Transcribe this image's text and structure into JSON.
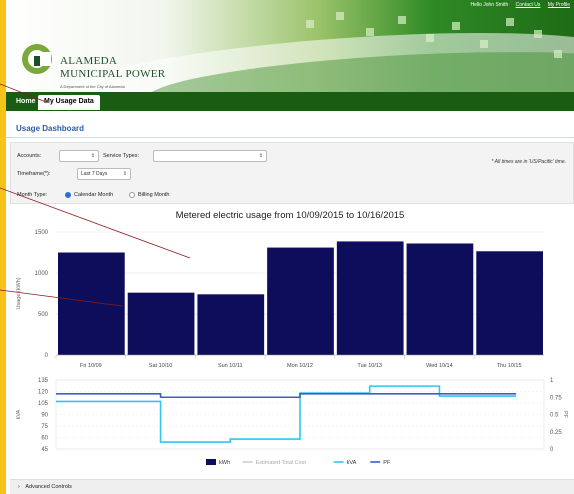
{
  "header": {
    "user_name": "Hello John Smith",
    "links": [
      "Contact Us",
      "My Profile"
    ],
    "brand_line1": "ALAMEDA",
    "brand_line2": "MUNICIPAL POWER",
    "tagline": "A Department of the City of Alameda"
  },
  "nav": {
    "tabs": [
      "Home",
      "My Usage Data"
    ],
    "active": "My Usage Data"
  },
  "dashboard": {
    "title": "Usage Dashboard"
  },
  "controls": {
    "accounts_label": "Accounts:",
    "accounts_value": "",
    "service_types_label": "Service Types:",
    "service_types_value": "",
    "timeframe_label": "Timeframe(*):",
    "timeframe_value": "Last 7 Days",
    "month_type_label": "Month Type:",
    "month_options": [
      "Calendar Month",
      "Billing Month"
    ],
    "month_selected": "Calendar Month",
    "tz_note": "* All times are in 'US/Pacific' time."
  },
  "chart_data": [
    {
      "type": "bar",
      "title": "Metered electric usage from 10/09/2015 to 10/16/2015",
      "ylabel": "Usage (kWh)",
      "categories": [
        "Fri 10/09",
        "Sat 10/10",
        "Sun 10/11",
        "Mon 10/12",
        "Tue 10/13",
        "Wed 10/14",
        "Thu 10/15"
      ],
      "values": [
        1250,
        760,
        740,
        1310,
        1385,
        1360,
        1265
      ],
      "ylim": [
        0,
        1500
      ],
      "yticks": [
        0,
        500,
        1000,
        1500
      ],
      "color": "#0d0d5c"
    },
    {
      "type": "line",
      "ylabel_left": "kVA",
      "ylabel_right": "PF",
      "yticks_left": [
        45,
        60,
        75,
        90,
        105,
        120,
        135
      ],
      "yticks_right": [
        "0",
        "0.25",
        "0.5",
        "0.75",
        "1"
      ],
      "ylim_left": [
        45,
        135
      ],
      "ylim_right": [
        0,
        1
      ],
      "series": [
        {
          "name": "kVA",
          "color": "#2fc6f0",
          "axis": "left",
          "steps": [
            {
              "from": 0,
              "to": 1.5,
              "value": 107
            },
            {
              "from": 1.5,
              "to": 2.5,
              "value": 54
            },
            {
              "from": 2.5,
              "to": 3.5,
              "value": 58
            },
            {
              "from": 3.5,
              "to": 4.5,
              "value": 118
            },
            {
              "from": 4.5,
              "to": 5.5,
              "value": 127
            },
            {
              "from": 5.5,
              "to": 6.6,
              "value": 114
            }
          ]
        },
        {
          "name": "PF",
          "color": "#3a5fc8",
          "axis": "right",
          "steps": [
            {
              "from": 0,
              "to": 1.5,
              "value": 0.8
            },
            {
              "from": 1.5,
              "to": 3.5,
              "value": 0.75
            },
            {
              "from": 3.5,
              "to": 6.6,
              "value": 0.8
            }
          ]
        }
      ]
    }
  ],
  "legend": [
    {
      "label": "kWh",
      "color": "#0d0d5c",
      "kind": "box"
    },
    {
      "label": "Estimated Total Cost",
      "color": "#cfcfcf",
      "kind": "line"
    },
    {
      "label": "kVA",
      "color": "#2fc6f0",
      "kind": "line"
    },
    {
      "label": "PF",
      "color": "#3a5fc8",
      "kind": "line"
    }
  ],
  "footer": {
    "advanced_controls": "Advanced Controls"
  },
  "colors": {
    "accent_green": "#1a5c12",
    "page_border": "#f6c416",
    "link_blue": "#2a5da8",
    "annotation": "#8b1a1a"
  }
}
